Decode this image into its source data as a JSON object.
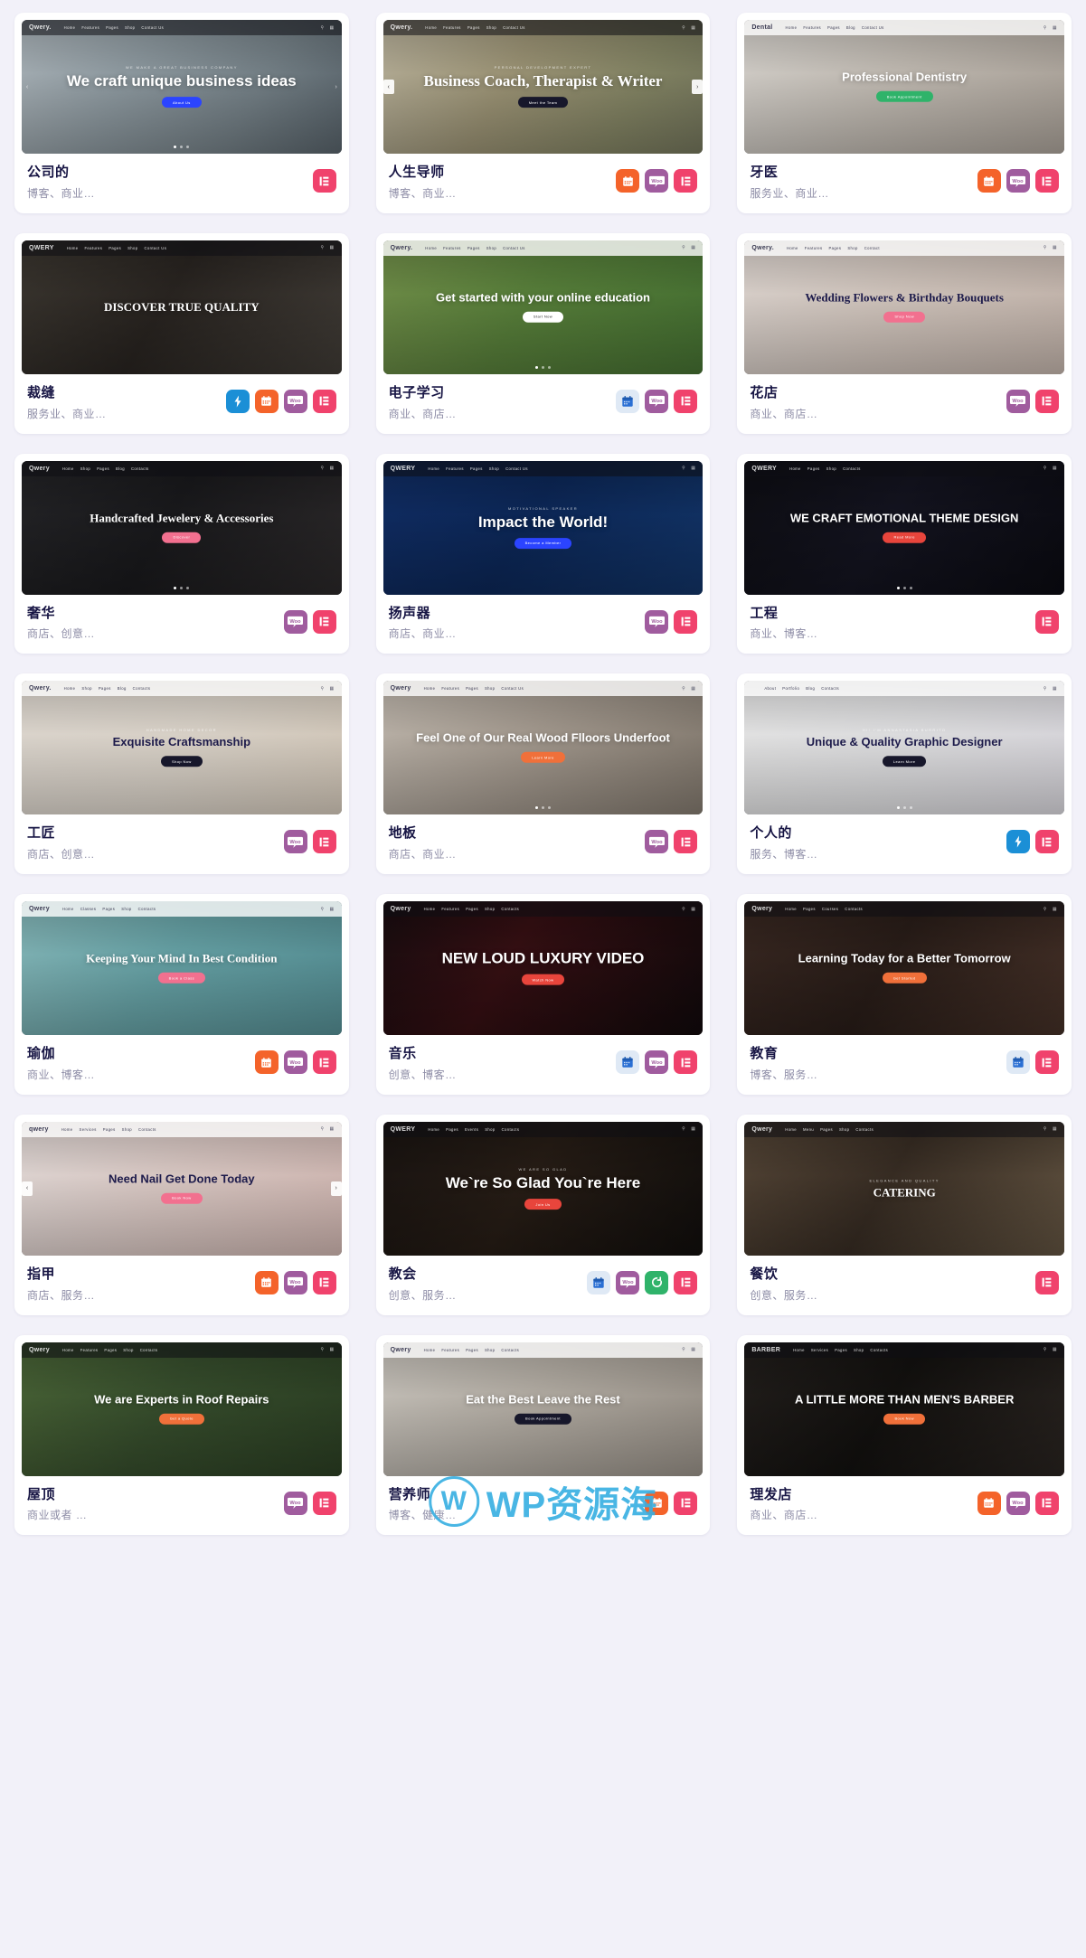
{
  "page": {
    "columns": 3,
    "accent_elementor": "#f0426c",
    "accent_woo": "#a05c9e",
    "accent_events": "#f4632a",
    "accent_rocket": "#1b8fd6",
    "background": "#f2f1f9",
    "card_background": "#ffffff",
    "title_color": "#171544",
    "tag_color": "#8d8ca6"
  },
  "watermark": {
    "mark": "W",
    "text": "WP",
    "text_cn": "资源海"
  },
  "cards": [
    {
      "name": "公司的",
      "tags": "博客、商业…",
      "badges": [
        "elementor"
      ],
      "logo": "Qwery.",
      "nav": [
        "Home",
        "Features",
        "Pages",
        "Shop",
        "Contact Us"
      ],
      "kicker": "WE MAKE A GREAT BUSINESS COMPANY",
      "title": "We craft unique business ideas",
      "cta": "About Us",
      "style": "corporate"
    },
    {
      "name": "人生导师",
      "tags": "博客、商业…",
      "badges": [
        "events",
        "woo",
        "elementor"
      ],
      "logo": "Qwery.",
      "nav": [
        "Home",
        "Features",
        "Pages",
        "Shop",
        "Contact Us"
      ],
      "kicker": "PERSONAL DEVELOPMENT EXPERT",
      "title": "Business Coach, Therapist & Writer",
      "cta": "Meet the Team",
      "style": "coach"
    },
    {
      "name": "牙医",
      "tags": "服务业、商业…",
      "badges": [
        "events",
        "woo",
        "elementor"
      ],
      "logo": "Dental",
      "nav": [
        "Home",
        "Features",
        "Pages",
        "Blog",
        "Contact Us"
      ],
      "kicker": "",
      "title": "Professional Dentistry",
      "cta": "Book Appointment",
      "style": "dental"
    },
    {
      "name": "裁缝",
      "tags": "服务业、商业…",
      "badges": [
        "rocket",
        "events",
        "woo",
        "elementor"
      ],
      "logo": "QWERY",
      "nav": [
        "Home",
        "Features",
        "Pages",
        "Shop",
        "Contact Us"
      ],
      "kicker": "",
      "title": "DISCOVER TRUE QUALITY",
      "cta": "",
      "style": "tailor"
    },
    {
      "name": "电子学习",
      "tags": "商业、商店…",
      "badges": [
        "bluecal",
        "woo",
        "elementor"
      ],
      "logo": "Qwery.",
      "nav": [
        "Home",
        "Features",
        "Pages",
        "Shop",
        "Contact Us"
      ],
      "kicker": "",
      "title": "Get started with your online education",
      "cta": "Start Now",
      "style": "elearning"
    },
    {
      "name": "花店",
      "tags": "商业、商店…",
      "badges": [
        "woo",
        "elementor"
      ],
      "logo": "Qwery.",
      "nav": [
        "Home",
        "Features",
        "Pages",
        "Shop",
        "Contact"
      ],
      "kicker": "",
      "title": "Wedding Flowers & Birthday Bouquets",
      "cta": "Shop Now",
      "style": "flower"
    },
    {
      "name": "奢华",
      "tags": "商店、创意…",
      "badges": [
        "woo",
        "elementor"
      ],
      "logo": "Qwery",
      "nav": [
        "Home",
        "Shop",
        "Pages",
        "Blog",
        "Contacts"
      ],
      "kicker": "",
      "title": "Handcrafted Jewelery & Accessories",
      "cta": "Discover",
      "style": "jewelry"
    },
    {
      "name": "扬声器",
      "tags": "商店、商业…",
      "badges": [
        "woo",
        "elementor"
      ],
      "logo": "QWERY",
      "nav": [
        "Home",
        "Features",
        "Pages",
        "Shop",
        "Contact Us"
      ],
      "kicker": "MOTIVATIONAL SPEAKER",
      "title": "Impact the World!",
      "cta": "Become a Member",
      "style": "speaker"
    },
    {
      "name": "工程",
      "tags": "商业、博客…",
      "badges": [
        "elementor"
      ],
      "logo": "QWERY",
      "nav": [
        "Home",
        "Pages",
        "Shop",
        "Contacts"
      ],
      "kicker": "",
      "title": "WE CRAFT EMOTIONAL THEME DESIGN",
      "cta": "Read More",
      "style": "engineering"
    },
    {
      "name": "工匠",
      "tags": "商店、创意…",
      "badges": [
        "woo",
        "elementor"
      ],
      "logo": "Qwery.",
      "nav": [
        "Home",
        "Shop",
        "Pages",
        "Blog",
        "Contacts"
      ],
      "kicker": "HANDMADE HOME DECOR",
      "title": "Exquisite Craftsmanship",
      "cta": "Shop Now",
      "style": "craftsman"
    },
    {
      "name": "地板",
      "tags": "商店、商业…",
      "badges": [
        "woo",
        "elementor"
      ],
      "logo": "Qwery",
      "nav": [
        "Home",
        "Features",
        "Pages",
        "Shop",
        "Contact Us"
      ],
      "kicker": "",
      "title": "Feel One of Our Real Wood Flloors Underfoot",
      "cta": "Learn More",
      "style": "flooring"
    },
    {
      "name": "个人的",
      "tags": "服务、博客…",
      "badges": [
        "rocket",
        "elementor"
      ],
      "logo": "",
      "nav": [
        "About",
        "Portfolio",
        "Blog",
        "Contacts"
      ],
      "kicker": "Hi! I'm Annastasia Burrito",
      "title": "Unique & Quality Graphic Designer",
      "cta": "Learn More",
      "style": "personal"
    },
    {
      "name": "瑜伽",
      "tags": "商业、博客…",
      "badges": [
        "events",
        "woo",
        "elementor"
      ],
      "logo": "Qwery",
      "nav": [
        "Home",
        "Classes",
        "Pages",
        "Shop",
        "Contacts"
      ],
      "kicker": "",
      "title": "Keeping Your Mind In Best Condition",
      "cta": "Book a Class",
      "style": "yoga"
    },
    {
      "name": "音乐",
      "tags": "创意、博客…",
      "badges": [
        "bluecal",
        "woo",
        "elementor"
      ],
      "logo": "Qwery",
      "nav": [
        "Home",
        "Features",
        "Pages",
        "Shop",
        "Contacts"
      ],
      "kicker": "",
      "title": "NEW LOUD LUXURY VIDEO",
      "cta": "Watch Now",
      "style": "music"
    },
    {
      "name": "教育",
      "tags": "博客、服务…",
      "badges": [
        "bluecal",
        "elementor"
      ],
      "logo": "Qwery",
      "nav": [
        "Home",
        "Pages",
        "Courses",
        "Contacts"
      ],
      "kicker": "",
      "title": "Learning Today for a Better Tomorrow",
      "cta": "Get Started",
      "style": "education"
    },
    {
      "name": "指甲",
      "tags": "商店、服务…",
      "badges": [
        "events",
        "woo",
        "elementor"
      ],
      "logo": "qwery",
      "nav": [
        "Home",
        "Services",
        "Pages",
        "Shop",
        "Contacts"
      ],
      "kicker": "",
      "title": "Need Nail Get Done Today",
      "cta": "Book Now",
      "style": "nails"
    },
    {
      "name": "教会",
      "tags": "创意、服务…",
      "badges": [
        "bluecal",
        "woo",
        "green",
        "elementor"
      ],
      "logo": "QWERY",
      "nav": [
        "Home",
        "Pages",
        "Events",
        "Shop",
        "Contacts"
      ],
      "kicker": "WE ARE SO GLAD",
      "title": "We`re So Glad You`re Here",
      "cta": "Join Us",
      "style": "church"
    },
    {
      "name": "餐饮",
      "tags": "创意、服务…",
      "badges": [
        "elementor"
      ],
      "logo": "Qwery",
      "nav": [
        "Home",
        "Menu",
        "Pages",
        "Shop",
        "Contacts"
      ],
      "kicker": "ELEGANCE AND QUALITY",
      "title": "CATERING",
      "cta": "",
      "style": "catering"
    },
    {
      "name": "屋顶",
      "tags": "商业或者 …",
      "badges": [
        "woo",
        "elementor"
      ],
      "logo": "Qwery",
      "nav": [
        "Home",
        "Features",
        "Pages",
        "Shop",
        "Contacts"
      ],
      "kicker": "",
      "title": "We are Experts in Roof Repairs",
      "cta": "Get a Quote",
      "style": "roofing"
    },
    {
      "name": "营养师",
      "tags": "博客、健康…",
      "badges": [
        "events",
        "elementor"
      ],
      "logo": "Qwery",
      "nav": [
        "Home",
        "Features",
        "Pages",
        "Shop",
        "Contacts"
      ],
      "kicker": "",
      "title": "Eat the Best Leave the Rest",
      "cta": "Book Appointment",
      "style": "nutrition"
    },
    {
      "name": "理发店",
      "tags": "商业、商店…",
      "badges": [
        "events",
        "woo",
        "elementor"
      ],
      "logo": "BARBER",
      "nav": [
        "Home",
        "Services",
        "Pages",
        "Shop",
        "Contacts"
      ],
      "kicker": "",
      "title": "A LITTLE MORE THAN MEN'S BARBER",
      "cta": "Book Now",
      "style": "barber"
    }
  ]
}
